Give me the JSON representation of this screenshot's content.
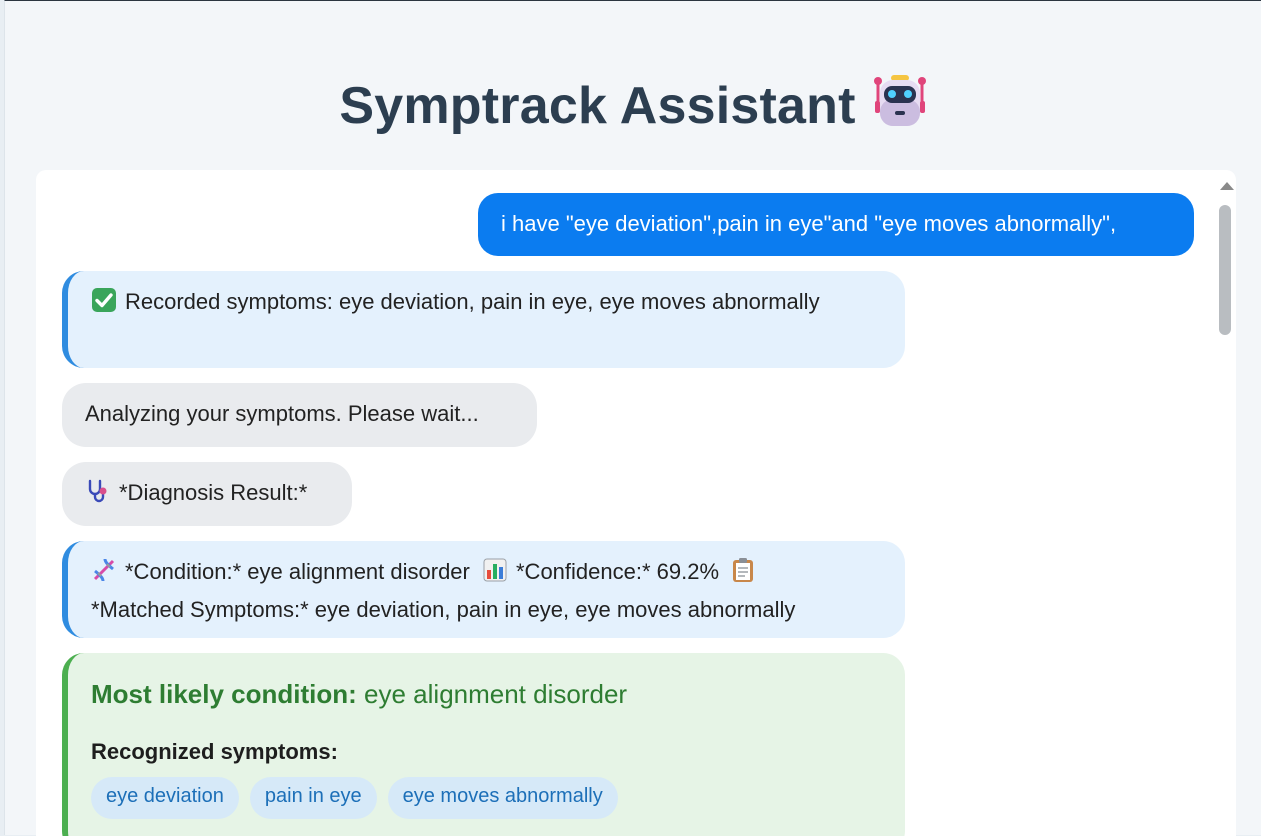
{
  "app": {
    "title": "Symptrack Assistant",
    "title_icon": "robot-icon"
  },
  "chat": {
    "user_message": "i have \"eye deviation\",pain in eye\"and \"eye moves abnormally\",",
    "recorded": {
      "icon": "check-mark-icon",
      "text": "Recorded symptoms: eye deviation, pain in eye, eye moves abnormally"
    },
    "analyzing": "Analyzing your symptoms. Please wait...",
    "diagnosis_header": {
      "icon": "stethoscope-icon",
      "text": "*Diagnosis Result:*"
    },
    "diagnosis_detail": {
      "condition_icon": "dna-icon",
      "condition_text": "*Condition:* eye alignment disorder",
      "confidence_icon": "bar-chart-icon",
      "confidence_text": "*Confidence:* 69.2%",
      "matched_icon": "clipboard-icon",
      "matched_text": "*Matched Symptoms:* eye deviation, pain in eye, eye moves abnormally"
    }
  },
  "result_card": {
    "likely_label": "Most likely condition:",
    "likely_value": "eye alignment disorder",
    "recognized_label": "Recognized symptoms:",
    "tags": [
      "eye deviation",
      "pain in eye",
      "eye moves abnormally"
    ]
  },
  "colors": {
    "user_bubble": "#0b7cf0",
    "bot_blue_bg": "#e4f1fd",
    "bot_blue_accent": "#2f8ce0",
    "bot_gray_bg": "#e9ebee",
    "result_bg": "#e6f4e6",
    "result_accent": "#4caf50",
    "result_title": "#2e7d32",
    "tag_bg": "#d6e9f8",
    "tag_text": "#1c6fb8"
  }
}
